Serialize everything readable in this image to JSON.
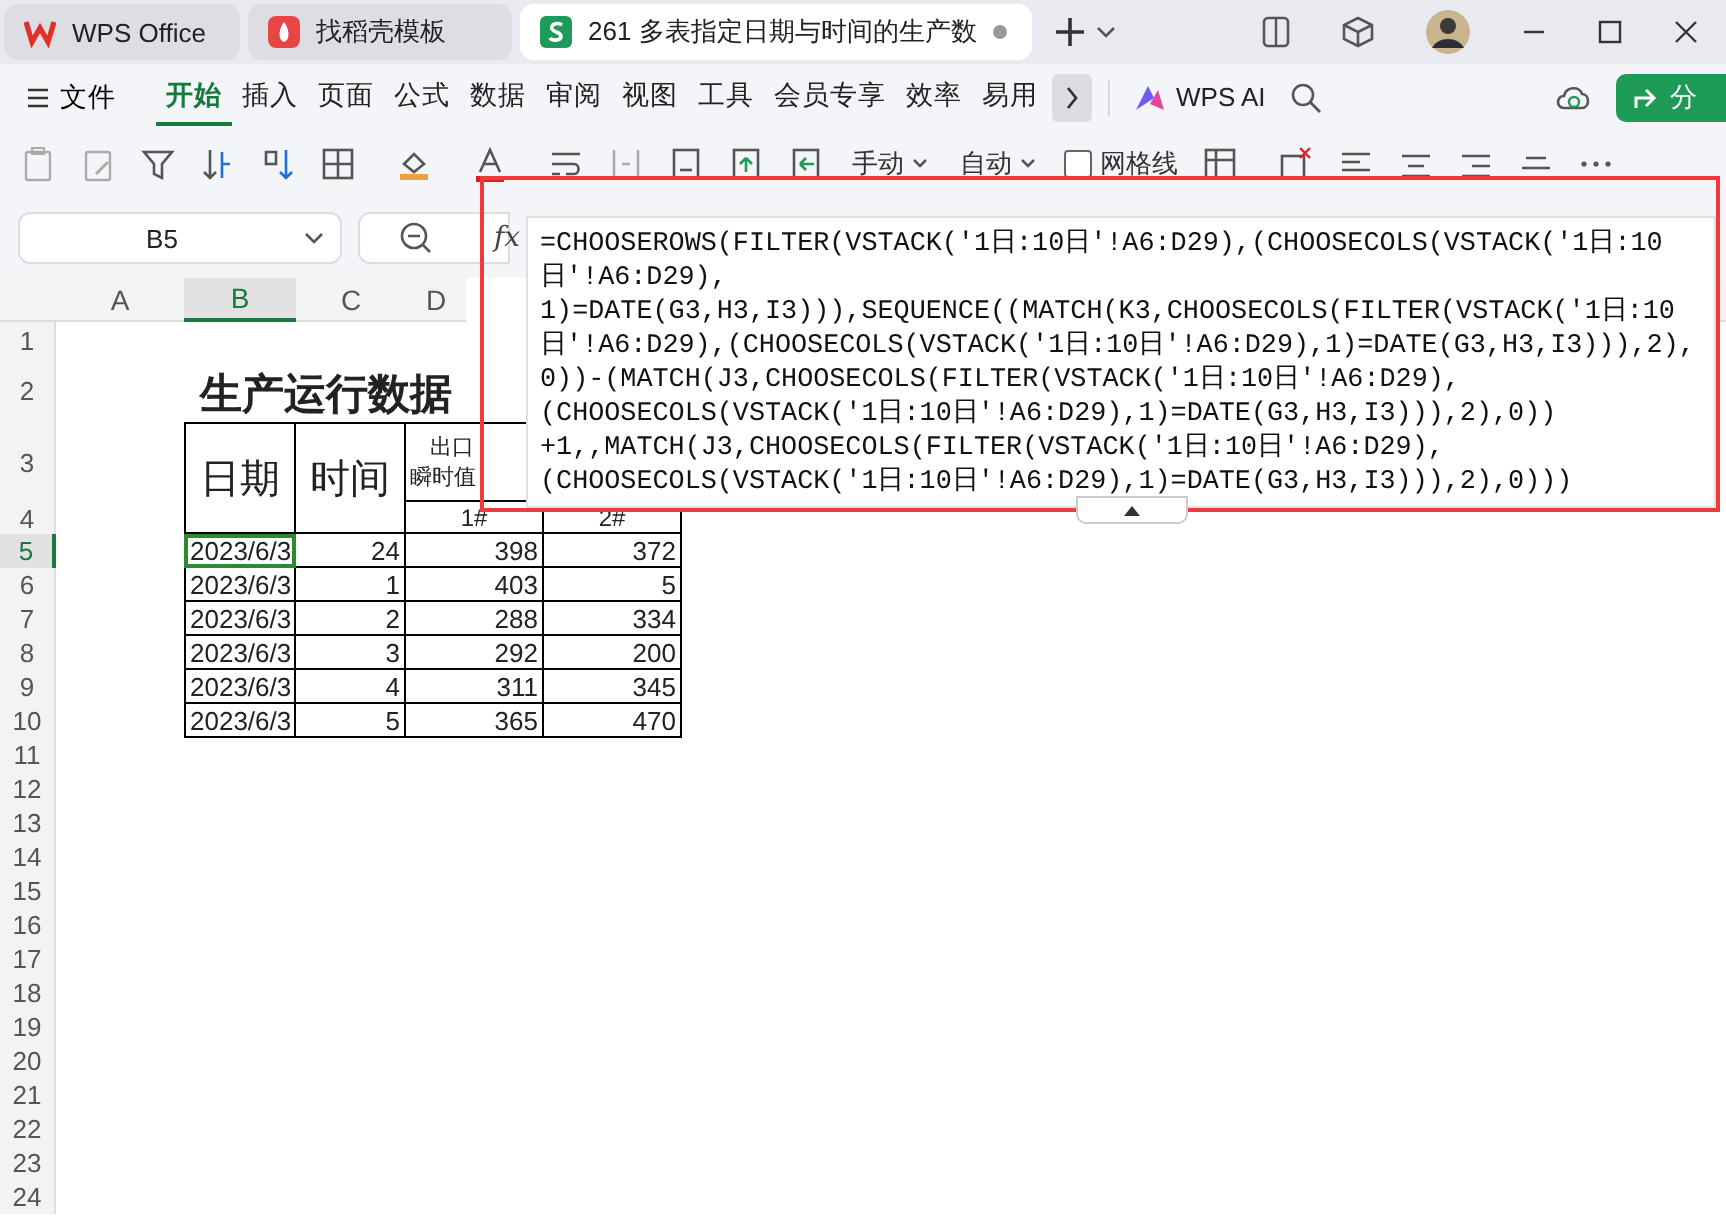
{
  "tabs": [
    {
      "label": "WPS Office",
      "kind": "home",
      "selected": false
    },
    {
      "label": "找稻壳模板",
      "kind": "template",
      "selected": false
    },
    {
      "label": "261 多表指定日期与时间的生产数",
      "kind": "sheet",
      "selected": true
    }
  ],
  "menu": {
    "file": "文件",
    "items": [
      {
        "label": "开始",
        "selected": true
      },
      {
        "label": "插入",
        "selected": false
      },
      {
        "label": "页面",
        "selected": false
      },
      {
        "label": "公式",
        "selected": false
      },
      {
        "label": "数据",
        "selected": false
      },
      {
        "label": "审阅",
        "selected": false
      },
      {
        "label": "视图",
        "selected": false
      },
      {
        "label": "工具",
        "selected": false
      },
      {
        "label": "会员专享",
        "selected": false
      },
      {
        "label": "效率",
        "selected": false
      },
      {
        "label": "易用",
        "selected": false
      }
    ],
    "ai": "WPS AI",
    "share": "分"
  },
  "toolbar": {
    "manual": "手动",
    "auto": "自动",
    "gridlines": {
      "label": "网格线",
      "checked": false
    }
  },
  "formula_bar": {
    "cell": "B5",
    "fx": "fx",
    "formula": [
      "=CHOOSEROWS(FILTER(VSTACK('1日:10日'!A6:D29),(CHOOSECOLS(VSTACK('1日:10",
      "日'!A6:D29),",
      "1)=DATE(G3,H3,I3))),SEQUENCE((MATCH(K3,CHOOSECOLS(FILTER(VSTACK('1日:10",
      "日'!A6:D29),(CHOOSECOLS(VSTACK('1日:10日'!A6:D29),1)=DATE(G3,H3,I3))),2),",
      "0))-(MATCH(J3,CHOOSECOLS(FILTER(VSTACK('1日:10日'!A6:D29),",
      "(CHOOSECOLS(VSTACK('1日:10日'!A6:D29),1)=DATE(G3,H3,I3))),2),0))",
      "+1,,MATCH(J3,CHOOSECOLS(FILTER(VSTACK('1日:10日'!A6:D29),",
      "(CHOOSECOLS(VSTACK('1日:10日'!A6:D29),1)=DATE(G3,H3,I3))),2),0)))"
    ]
  },
  "sheet": {
    "columns": [
      {
        "label": "A",
        "selected": false
      },
      {
        "label": "B",
        "selected": true
      },
      {
        "label": "C",
        "selected": false
      },
      {
        "label": "D",
        "selected": false
      }
    ],
    "rows": [
      {
        "label": "1",
        "selected": false
      },
      {
        "label": "2",
        "selected": false
      },
      {
        "label": "3",
        "selected": false
      },
      {
        "label": "4",
        "selected": false
      },
      {
        "label": "5",
        "selected": true
      },
      {
        "label": "6",
        "selected": false
      },
      {
        "label": "7",
        "selected": false
      },
      {
        "label": "8",
        "selected": false
      },
      {
        "label": "9",
        "selected": false
      },
      {
        "label": "10",
        "selected": false
      },
      {
        "label": "11",
        "selected": false
      },
      {
        "label": "12",
        "selected": false
      },
      {
        "label": "13",
        "selected": false
      },
      {
        "label": "14",
        "selected": false
      },
      {
        "label": "15",
        "selected": false
      },
      {
        "label": "16",
        "selected": false
      },
      {
        "label": "17",
        "selected": false
      },
      {
        "label": "18",
        "selected": false
      },
      {
        "label": "19",
        "selected": false
      },
      {
        "label": "20",
        "selected": false
      },
      {
        "label": "21",
        "selected": false
      },
      {
        "label": "22",
        "selected": false
      },
      {
        "label": "23",
        "selected": false
      },
      {
        "label": "24",
        "selected": false
      }
    ],
    "title": "生产运行数据",
    "headers": {
      "date": "日期",
      "time": "时间",
      "group": "出口",
      "sub": "瞬时值",
      "col1": "1#",
      "col2": "2#"
    },
    "data": [
      {
        "date": "2023/6/3",
        "time": "24",
        "v1": "398",
        "v2": "372",
        "selected": true
      },
      {
        "date": "2023/6/3",
        "time": "1",
        "v1": "403",
        "v2": "5",
        "selected": false
      },
      {
        "date": "2023/6/3",
        "time": "2",
        "v1": "288",
        "v2": "334",
        "selected": false
      },
      {
        "date": "2023/6/3",
        "time": "3",
        "v1": "292",
        "v2": "200",
        "selected": false
      },
      {
        "date": "2023/6/3",
        "time": "4",
        "v1": "311",
        "v2": "345",
        "selected": false
      },
      {
        "date": "2023/6/3",
        "time": "5",
        "v1": "365",
        "v2": "470",
        "selected": false
      }
    ]
  }
}
